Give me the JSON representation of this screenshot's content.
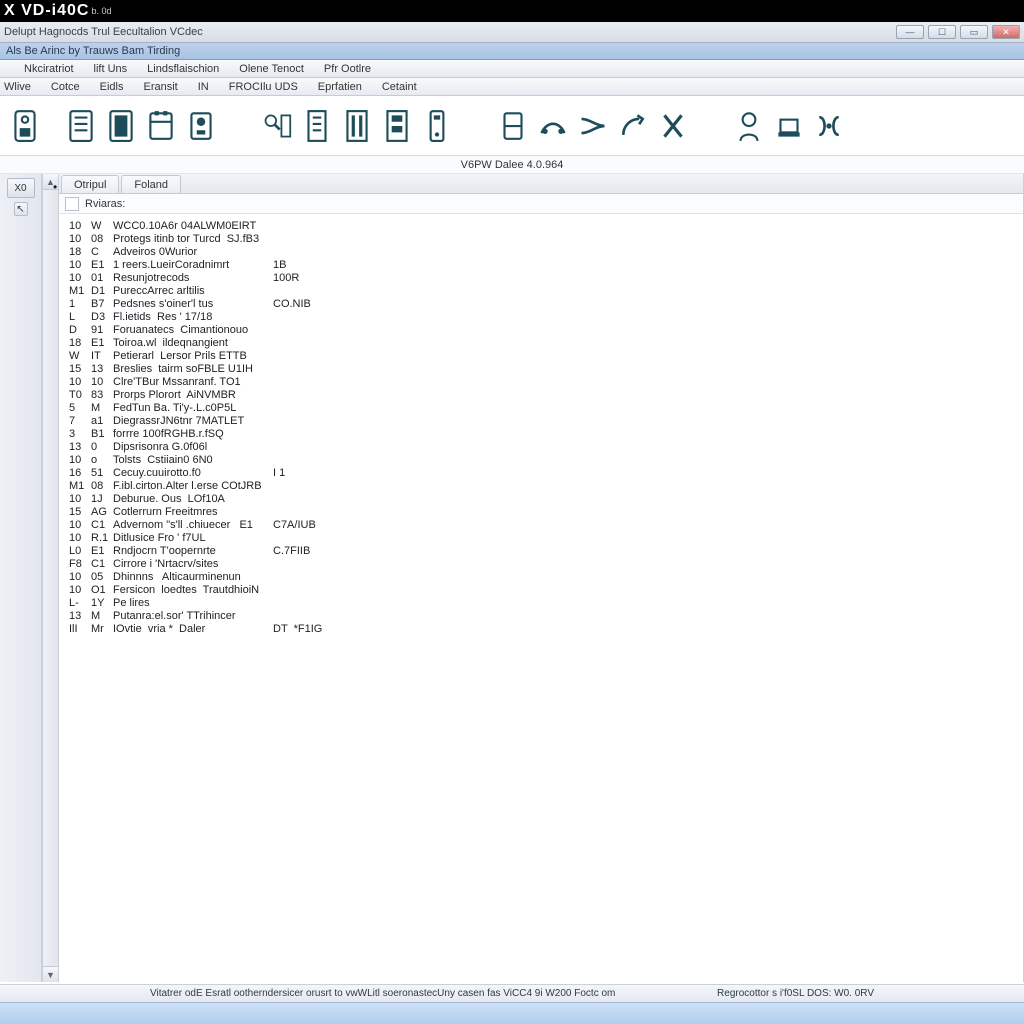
{
  "titlebar": {
    "logo": "X VD-i40C",
    "logo_sub": "b. 0d"
  },
  "caption": "Delupt Hagnocds Trul Eecultalion VCdec",
  "bluebar": "Als  Be Arinc   by  Trauws  Bam  Tirding",
  "menu1": {
    "m0": "",
    "m1": "Nkciratriot",
    "m2": "lift Uns",
    "m3": "Lindsflaischion",
    "m4": "Olene Tenoct",
    "m5": "Pfr Ootlre"
  },
  "menu2": {
    "m0": "Wlive",
    "m1": "Cotce",
    "m2": "Eidls",
    "m3": "Eransit",
    "m4": "IN",
    "m5": "FROCIlu UDS",
    "m6": "Eprfatien",
    "m7": "Cetaint"
  },
  "subcaption": "V6PW Dalee 4.0.964",
  "leftcol": {
    "btn1": "X0",
    "btn2": "↖"
  },
  "tabs": {
    "t0": "Otripul",
    "t1": "Foland"
  },
  "fieldrow_label": "Rviaras:",
  "status_left": "Vitatrer odE Esratl ootherndersicer orusrt to vwWLitl  soeronastecUny casen fas ViCC4 9i W200 Foctc om",
  "status_right": "Regrocottor s i'f0SL DOS: W0. 0RV",
  "rows": [
    {
      "c1": "10",
      "c2": "W",
      "c3": "WCC0.10A6r 04ALWM0EIRT",
      "c4": ""
    },
    {
      "c1": "10",
      "c2": "08",
      "c3": "Protegs itinb tor Turcd  SJ.fB3",
      "c4": ""
    },
    {
      "c1": "18",
      "c2": "C",
      "c3": "Adveiros 0Wurior",
      "c4": ""
    },
    {
      "c1": "10",
      "c2": "E1",
      "c3": "1 reers.LueirCoradnimrt",
      "c4": "1B"
    },
    {
      "c1": "10",
      "c2": "01",
      "c3": "Resunjotrecods",
      "c4": "100R"
    },
    {
      "c1": "M1",
      "c2": "D1",
      "c3": "PureccArrec arltilis",
      "c4": ""
    },
    {
      "c1": "1",
      "c2": "B7",
      "c3": "Pedsnes s'oiner'l tus",
      "c4": "CO.NIB"
    },
    {
      "c1": "L",
      "c2": "D3",
      "c3": "Fl.ietids  Res ' 17/18",
      "c4": ""
    },
    {
      "c1": "D",
      "c2": "91",
      "c3": "Foruanatecs  Cimantionouo",
      "c4": ""
    },
    {
      "c1": "18",
      "c2": "E1",
      "c3": "Toiroa.wl  ildeqnangient",
      "c4": ""
    },
    {
      "c1": "W",
      "c2": "IT",
      "c3": "Petierarl  Lersor Prils ETTB",
      "c4": ""
    },
    {
      "c1": "15",
      "c2": "13",
      "c3": "Breslies  tairm soFBLE U1IH",
      "c4": ""
    },
    {
      "c1": "10",
      "c2": "10",
      "c3": "Clre'TBur Mssanranf. TO1",
      "c4": ""
    },
    {
      "c1": "T0",
      "c2": "83",
      "c3": "Prorps Plorort  AiNVMBR",
      "c4": ""
    },
    {
      "c1": "5",
      "c2": "M",
      "c3": "FedTun Ba. Ti'y-.L.c0P5L",
      "c4": ""
    },
    {
      "c1": "7",
      "c2": "a1",
      "c3": "DiegrassrJN6tnr 7MATLET",
      "c4": ""
    },
    {
      "c1": "3",
      "c2": "B1",
      "c3": "forrre 100fRGHB.r.fSQ",
      "c4": ""
    },
    {
      "c1": "13",
      "c2": "0",
      "c3": "Dipsrisonra G.0f06l",
      "c4": ""
    },
    {
      "c1": "10",
      "c2": "o",
      "c3": "Tolsts  Cstiiain0 6N0",
      "c4": ""
    },
    {
      "c1": "16",
      "c2": "51",
      "c3": "Cecuy.cuuirotto.f0",
      "c4": "I 1"
    },
    {
      "c1": "M1",
      "c2": "08",
      "c3": "F.ibl.cirton.Alter l.erse COtJRB",
      "c4": ""
    },
    {
      "c1": "10",
      "c2": "1J",
      "c3": "Deburue. Ous  LOf10A",
      "c4": ""
    },
    {
      "c1": "15",
      "c2": "AG",
      "c3": "Cotlerrurn Freeitmres",
      "c4": ""
    },
    {
      "c1": "10",
      "c2": "C1",
      "c3": "Advernom \"s'll .chiuecer   E1",
      "c4": "C7A/IUB"
    },
    {
      "c1": "10",
      "c2": "R.1",
      "c3": "Ditlusice Fro ' f7UL",
      "c4": ""
    },
    {
      "c1": "L0",
      "c2": "E1",
      "c3": "Rndjocrn T'oopernrte",
      "c4": "C.7FIIB"
    },
    {
      "c1": "F8",
      "c2": "C1",
      "c3": "Cirrore i 'Nrtacrv/sites",
      "c4": ""
    },
    {
      "c1": "10",
      "c2": "05",
      "c3": "Dhinnns   Alticaurminenun",
      "c4": ""
    },
    {
      "c1": "10",
      "c2": "O1",
      "c3": "Fersicon  loedtes  TrautdhioiN",
      "c4": ""
    },
    {
      "c1": "L-",
      "c2": "1Y",
      "c3": "Pe lires",
      "c4": ""
    },
    {
      "c1": "13",
      "c2": "M",
      "c3": "Putanra:el.sor' TTrihincer",
      "c4": ""
    },
    {
      "c1": "IlI",
      "c2": "Mr",
      "c3": "IOvtie  vria *  Daler",
      "c4": "DT  *F1IG"
    }
  ]
}
